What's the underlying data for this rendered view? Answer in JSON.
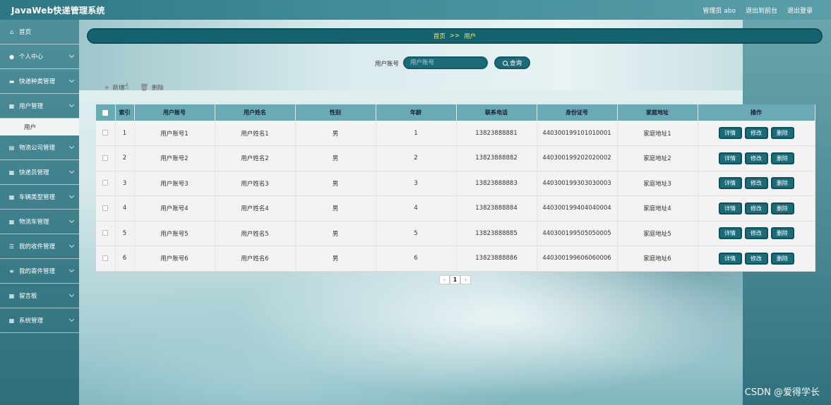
{
  "header": {
    "title": "JavaWeb快递管理系统",
    "links": [
      "管理员 abo",
      "退出到前台",
      "退出登录"
    ]
  },
  "sidebar": {
    "items": [
      {
        "label": "首页",
        "icon": "home-icon",
        "glyph": "⌂",
        "chevron": false
      },
      {
        "label": "个人中心",
        "icon": "user-icon",
        "glyph": "●",
        "chevron": true
      },
      {
        "label": "快递种类管理",
        "icon": "truck-icon",
        "glyph": "▬",
        "chevron": true
      },
      {
        "label": "用户管理",
        "icon": "grid-icon",
        "glyph": "▦",
        "chevron": true,
        "expanded": true
      },
      {
        "label": "物流公司管理",
        "icon": "building-icon",
        "glyph": "▤",
        "chevron": true
      },
      {
        "label": "快递员管理",
        "icon": "grid-icon",
        "glyph": "▦",
        "chevron": true
      },
      {
        "label": "车辆类型管理",
        "icon": "grid-icon",
        "glyph": "▦",
        "chevron": true
      },
      {
        "label": "物流车管理",
        "icon": "grid-icon",
        "glyph": "▦",
        "chevron": true
      },
      {
        "label": "我的收件管理",
        "icon": "sliders-icon",
        "glyph": "☰",
        "chevron": true
      },
      {
        "label": "我的寄件管理",
        "icon": "list-icon",
        "glyph": "≡",
        "chevron": true
      },
      {
        "label": "留言板",
        "icon": "grid-icon",
        "glyph": "▦",
        "chevron": true
      },
      {
        "label": "系统管理",
        "icon": "grid-icon",
        "glyph": "▦",
        "chevron": true
      }
    ],
    "submenu": {
      "label": "用户"
    }
  },
  "breadcrumb": {
    "home": "首页",
    "sep": ">>",
    "current": "用户"
  },
  "search": {
    "label": "用户账号",
    "placeholder": "用户账号",
    "button": "查询"
  },
  "actions": {
    "add": "新增",
    "delete": "删除"
  },
  "table": {
    "columns": [
      "索引",
      "用户账号",
      "用户姓名",
      "性别",
      "年龄",
      "联系电话",
      "身份证号",
      "家庭地址",
      "操作"
    ],
    "rows": [
      [
        "1",
        "用户账号1",
        "用户姓名1",
        "男",
        "1",
        "13823888881",
        "440300199101010001",
        "家庭地址1"
      ],
      [
        "2",
        "用户账号2",
        "用户姓名2",
        "男",
        "2",
        "13823888882",
        "440300199202020002",
        "家庭地址2"
      ],
      [
        "3",
        "用户账号3",
        "用户姓名3",
        "男",
        "3",
        "13823888883",
        "440300199303030003",
        "家庭地址3"
      ],
      [
        "4",
        "用户账号4",
        "用户姓名4",
        "男",
        "4",
        "13823888884",
        "440300199404040004",
        "家庭地址4"
      ],
      [
        "5",
        "用户账号5",
        "用户姓名5",
        "男",
        "5",
        "13823888885",
        "440300199505050005",
        "家庭地址5"
      ],
      [
        "6",
        "用户账号6",
        "用户姓名6",
        "男",
        "6",
        "13823888886",
        "440300199606060006",
        "家庭地址6"
      ]
    ],
    "row_buttons": [
      "详情",
      "修改",
      "删除"
    ]
  },
  "pagination": {
    "prev": "‹",
    "page": "1",
    "next": "›"
  },
  "watermark": "CSDN @爱得学长"
}
